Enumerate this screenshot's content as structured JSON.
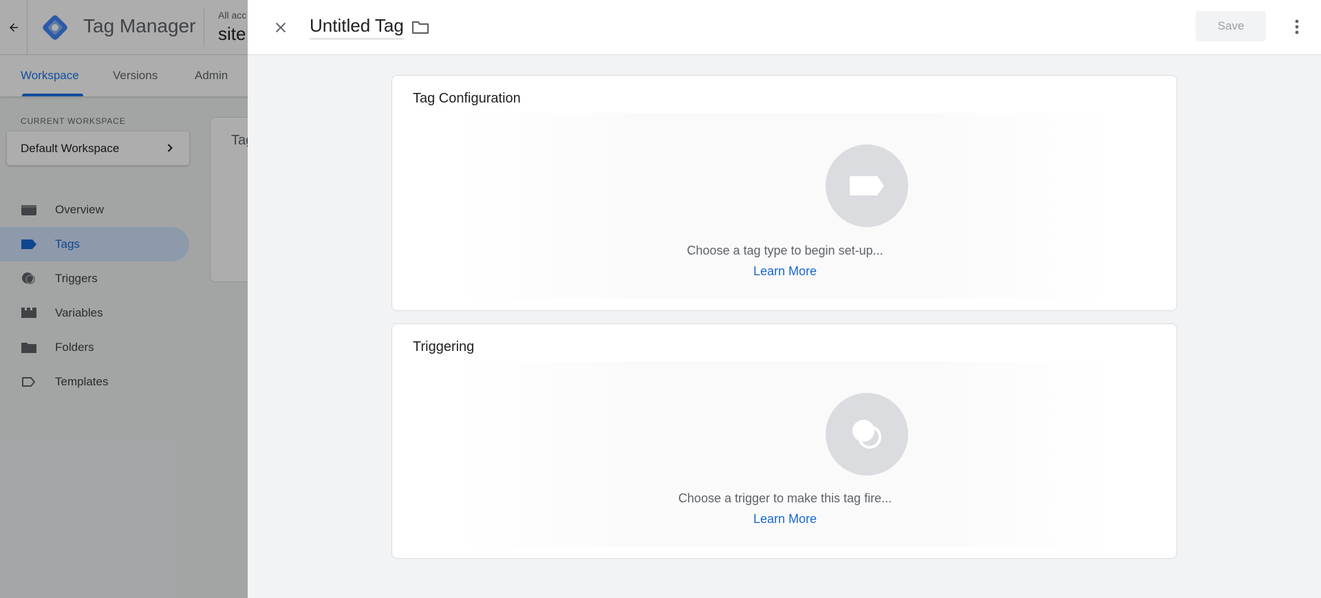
{
  "app": {
    "product_name": "Tag Manager",
    "account_label": "All acc",
    "container_name": "site"
  },
  "nav_tabs": [
    {
      "label": "Workspace",
      "active": true
    },
    {
      "label": "Versions",
      "active": false
    },
    {
      "label": "Admin",
      "active": false
    }
  ],
  "workspace": {
    "section_label": "CURRENT WORKSPACE",
    "name": "Default Workspace"
  },
  "sidebar": {
    "items": [
      {
        "label": "Overview",
        "icon": "overview-icon",
        "active": false
      },
      {
        "label": "Tags",
        "icon": "tag-icon",
        "active": true
      },
      {
        "label": "Triggers",
        "icon": "trigger-icon",
        "active": false
      },
      {
        "label": "Variables",
        "icon": "variables-icon",
        "active": false
      },
      {
        "label": "Folders",
        "icon": "folder-icon",
        "active": false
      },
      {
        "label": "Templates",
        "icon": "template-icon",
        "active": false
      }
    ]
  },
  "background_card": {
    "title": "Tag"
  },
  "panel": {
    "title": "Untitled Tag",
    "save_label": "Save",
    "save_enabled": false,
    "tag_configuration": {
      "title": "Tag Configuration",
      "hint": "Choose a tag type to begin set-up...",
      "learn_more": "Learn More"
    },
    "triggering": {
      "title": "Triggering",
      "hint": "Choose a trigger to make this tag fire...",
      "learn_more": "Learn More"
    }
  },
  "colors": {
    "accent": "#1a73e8",
    "link": "#1967d2",
    "active_nav_bg": "#d2e3fc",
    "placeholder_circle": "#dadce0"
  }
}
